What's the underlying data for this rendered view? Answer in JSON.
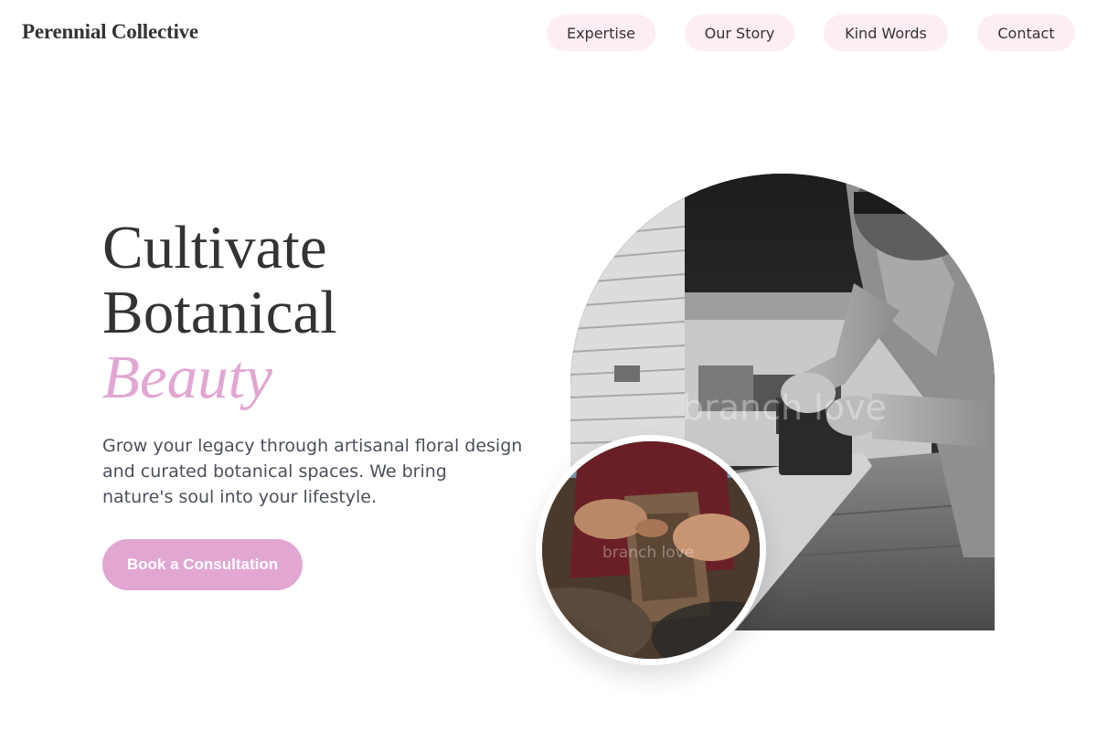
{
  "header": {
    "brand": "Perennial Collective",
    "nav": [
      {
        "label": "Expertise"
      },
      {
        "label": "Our Story"
      },
      {
        "label": "Kind Words"
      },
      {
        "label": "Contact"
      }
    ]
  },
  "hero": {
    "headline_line1": "Cultivate",
    "headline_line2": "Botanical",
    "headline_accent": "Beauty",
    "lede": "Grow your legacy through artisanal floral design and curated botanical spaces. We bring nature's soul into your lifestyle.",
    "cta_label": "Book a Consultation"
  },
  "images": {
    "arch_watermark": "branch love",
    "circle_watermark": "branch love"
  },
  "colors": {
    "accent": "#e2a6d3",
    "nav_pill": "#fdeef2",
    "text": "#333333"
  }
}
